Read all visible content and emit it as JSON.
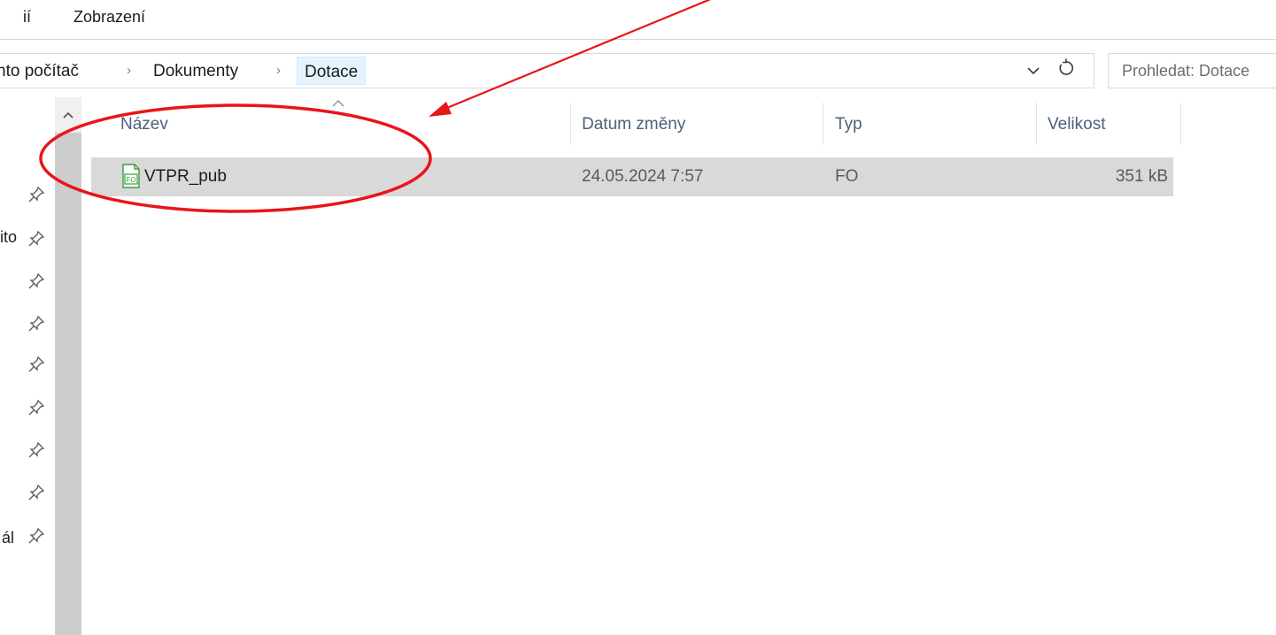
{
  "ribbon": {
    "tab_partial": "ií",
    "tab_view": "Zobrazení"
  },
  "address_bar": {
    "crumbs": [
      "nto počítač",
      "Dokumenty",
      "Dotace"
    ],
    "separator": "›"
  },
  "search": {
    "placeholder": "Prohledat: Dotace"
  },
  "nav_pane": {
    "labels": [
      "ito",
      "ál"
    ]
  },
  "columns": {
    "name": "Název",
    "modified": "Datum změny",
    "type": "Typ",
    "size": "Velikost"
  },
  "files": [
    {
      "name": "VTPR_pub",
      "modified": "24.05.2024 7:57",
      "type": "FO",
      "size": "351 kB",
      "icon": "fo-file-icon",
      "icon_text": "FO"
    }
  ],
  "colors": {
    "selection": "#d9d9d9",
    "annotation": "#e8151a",
    "header_text": "#4c607a",
    "icon_green": "#3c9d3c"
  }
}
